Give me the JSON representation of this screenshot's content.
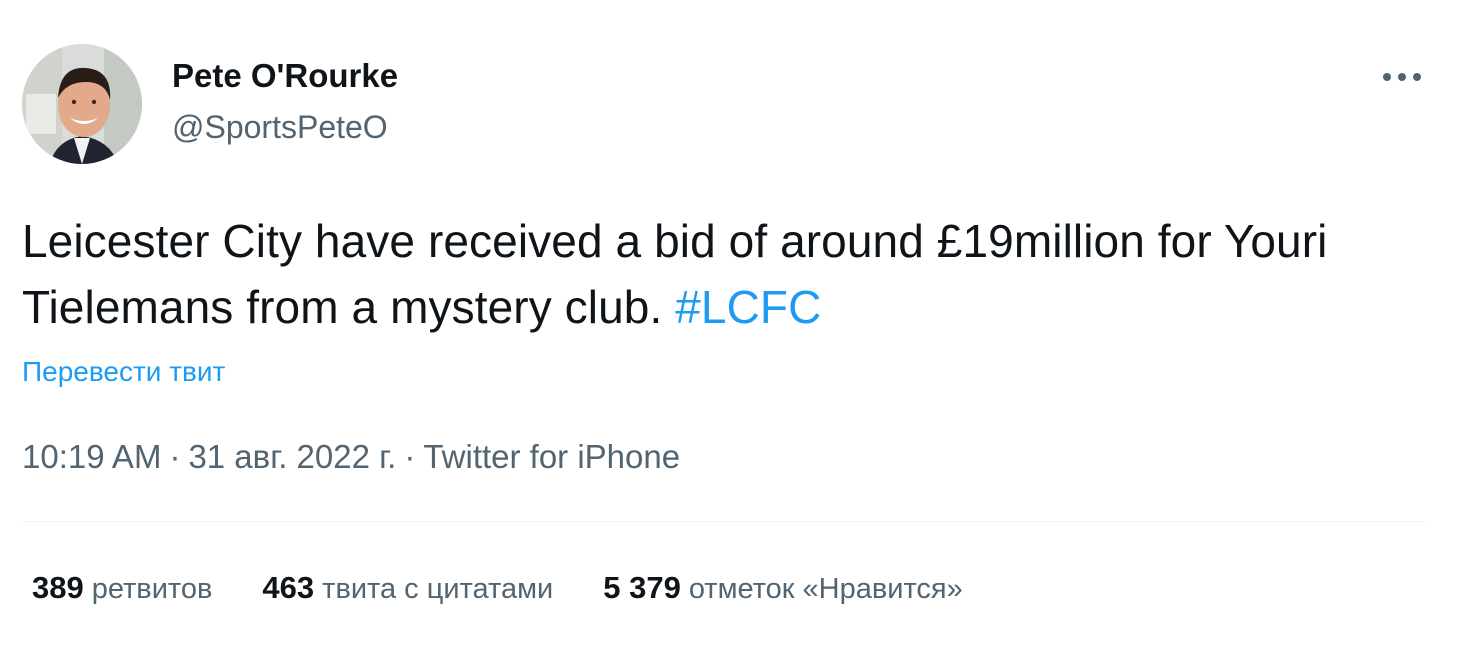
{
  "author": {
    "name": "Pete O'Rourke",
    "handle": "@SportsPeteO",
    "avatar_icon": "profile-photo"
  },
  "tweet": {
    "text": "Leicester City have received a bid of around £19million for Youri Tielemans from a mystery club.",
    "hashtag": "#LCFC",
    "translate_label": "Перевести твит"
  },
  "meta": {
    "time": "10:19 AM",
    "separator": "·",
    "date": "31 авг. 2022 г.",
    "source": "Twitter for iPhone"
  },
  "stats": {
    "retweets": {
      "count": "389",
      "label": "ретвитов"
    },
    "quotes": {
      "count": "463",
      "label": "твита с цитатами"
    },
    "likes": {
      "count": "5 379",
      "label": "отметок «Нравится»"
    }
  },
  "colors": {
    "link": "#1d9bf0",
    "secondary_text": "#536471",
    "primary_text": "#0f1419",
    "divider": "#eff3f4"
  },
  "icons": {
    "more": "more-horizontal-icon"
  }
}
